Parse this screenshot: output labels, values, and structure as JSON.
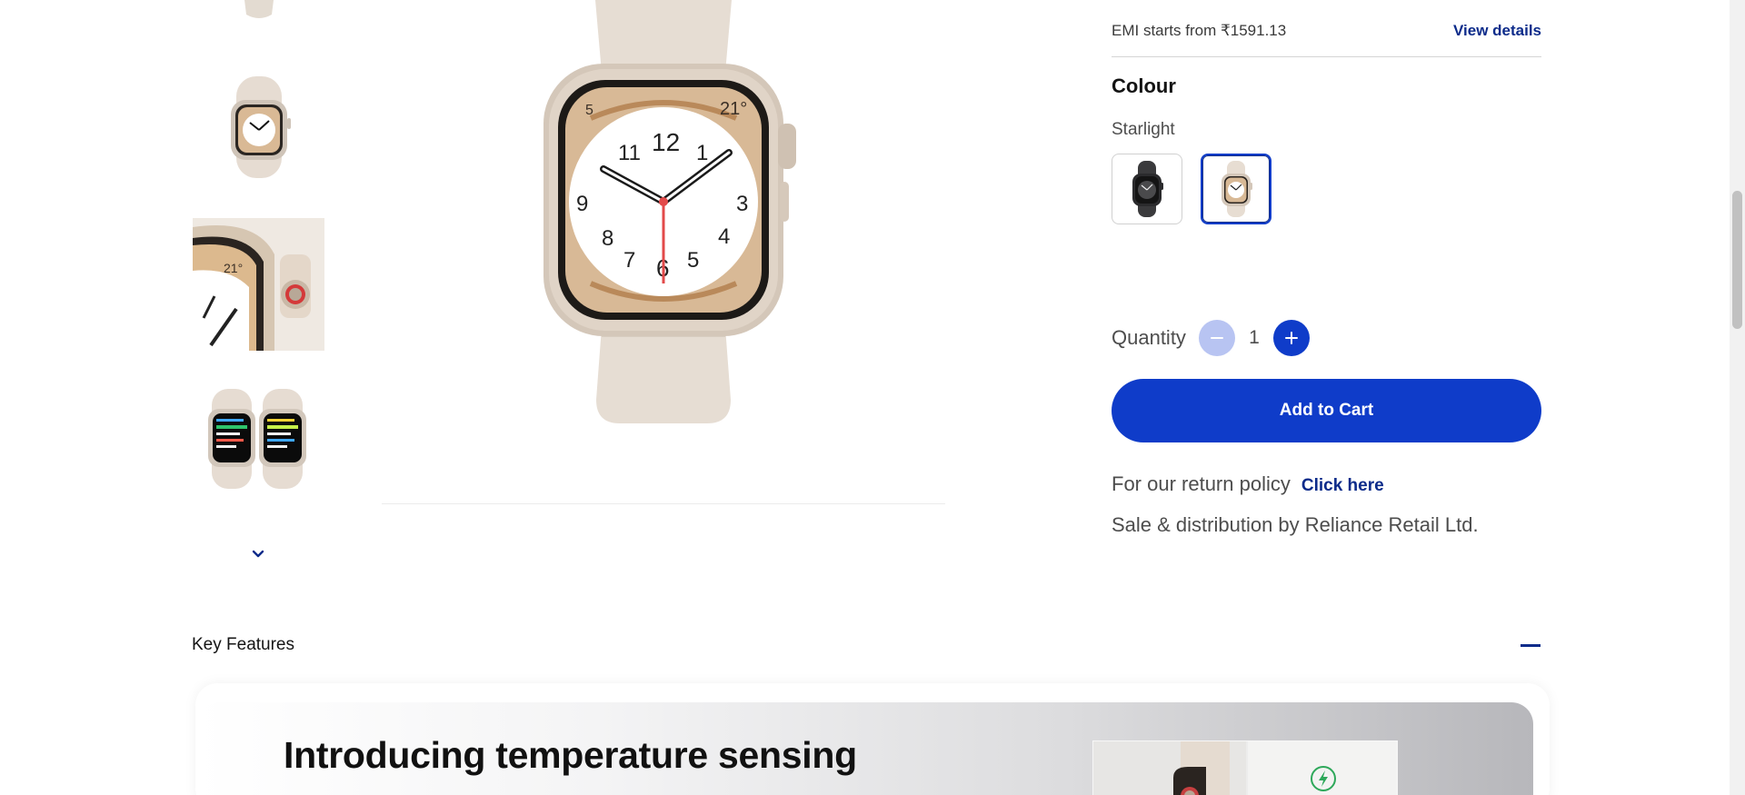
{
  "emi": {
    "text": "EMI starts from ₹1591.13",
    "link": "View details"
  },
  "colour": {
    "heading": "Colour",
    "selected": "Starlight",
    "swatches": [
      {
        "variant": "dark",
        "color": "#2b2b2d",
        "selected": false
      },
      {
        "variant": "starlight",
        "color": "#e7ddd2",
        "selected": true
      }
    ]
  },
  "quantity": {
    "label": "Quantity",
    "value": "1",
    "minus_icon": "minus-icon",
    "plus_icon": "plus-icon"
  },
  "cart": {
    "button": "Add to Cart"
  },
  "policy": {
    "text": "For our return policy",
    "link": "Click here"
  },
  "seller": {
    "text": "Sale & distribution by Reliance Retail Ltd."
  },
  "key_features": {
    "title": "Key Features",
    "toggle_icon": "collapse-minus-icon",
    "banner_heading": "Introducing temperature sensing"
  },
  "colors": {
    "brand_blue": "#0f3cc9",
    "link_navy": "#0c2b8a",
    "minus_disabled": "#b8c4f2",
    "watch_starlight": "#e7ddd2"
  }
}
